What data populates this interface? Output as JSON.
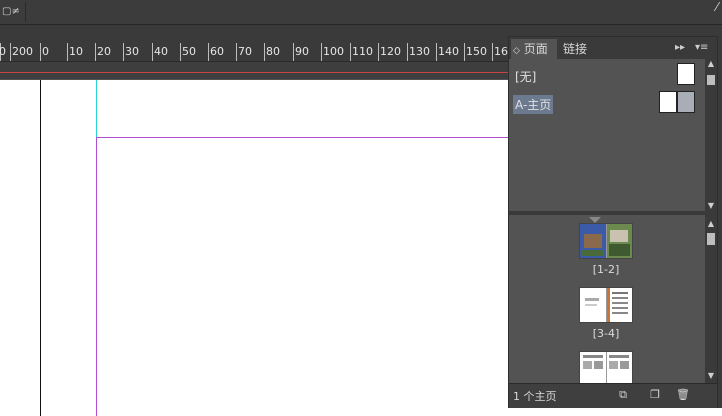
{
  "ruler": {
    "labels": [
      "0",
      "200",
      "0",
      "10",
      "20",
      "30",
      "40",
      "50",
      "60",
      "70",
      "80",
      "90",
      "100",
      "110",
      "120",
      "130",
      "140",
      "150",
      "16"
    ]
  },
  "panel": {
    "tabs": [
      {
        "label": "页面",
        "active": true
      },
      {
        "label": "链接",
        "active": false
      }
    ],
    "masters": [
      {
        "label": "[无]",
        "selected": false
      },
      {
        "label": "A-主页",
        "selected": true
      }
    ],
    "spreads": [
      {
        "label": "[1-2]"
      },
      {
        "label": "[3-4]"
      },
      {
        "label": ""
      }
    ],
    "status": "1 个主页"
  },
  "icons": {
    "tab_arrow": "collapse-arrows-icon",
    "panel_menu": "panel-menu-icon",
    "new_page": "new-page-icon",
    "delete": "trash-icon",
    "pages_options": "edit-page-size-icon"
  },
  "colors": {
    "margin_guide": "#b04dd0",
    "bleed_guide": "#28d4d4",
    "selected_master": "#6b7a8f"
  }
}
